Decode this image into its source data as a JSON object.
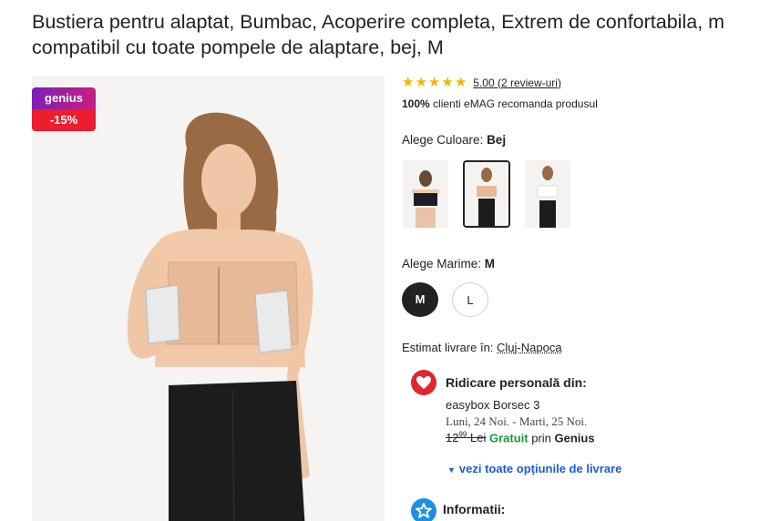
{
  "product": {
    "title_line1": "Bustiera pentru alaptat, Bumbac, Acoperire completa, Extrem de confortabila, m",
    "title_line2": "compatibil cu toate pompele de alaptare, bej, M"
  },
  "badge": {
    "genius": "genius",
    "discount": "-15%"
  },
  "rating": {
    "stars": 5,
    "text": "5.00 (2 review-uri)",
    "recommend_bold": "100%",
    "recommend_rest": " clienti eMAG recomanda produsul"
  },
  "color": {
    "label": "Alege Culoare: ",
    "selected": "Bej",
    "options": [
      "Negru",
      "Bej",
      "Alb"
    ]
  },
  "size": {
    "label": "Alege Marime: ",
    "selected": "M",
    "options": [
      "M",
      "L"
    ]
  },
  "delivery": {
    "label": "Estimat livrare în: ",
    "city": "Cluj-Napoca"
  },
  "pickup": {
    "title": "Ridicare personală din:",
    "location": "easybox Borsec 3",
    "date": "Luni, 24 Noi. - Marti, 25 Noi.",
    "old_price_int": "12",
    "old_price_dec": "99",
    "old_price_cur": "Lei",
    "free": "Gratuit",
    "via": " prin ",
    "genius": "Genius",
    "all_options": "vezi toate opțiunile de livrare"
  },
  "info": {
    "title": "Informatii:"
  },
  "colors": {
    "accent_red": "#e0262f",
    "link_blue": "#1a5bd8",
    "free_green": "#1b9a3b",
    "star": "#f5b400"
  }
}
